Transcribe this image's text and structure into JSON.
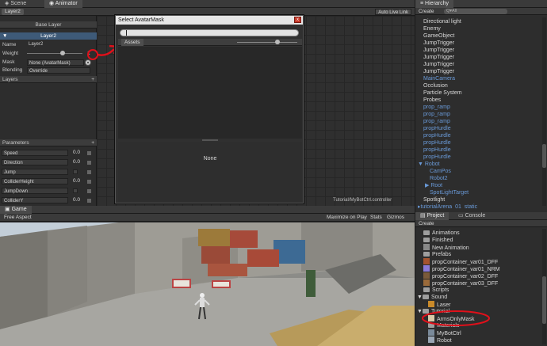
{
  "animator": {
    "tabs": [
      "Scene",
      "Animator"
    ],
    "breadcrumb": "Layer2",
    "auto_live_link": "Auto Live Link",
    "base_layer": "Base Layer",
    "layer_header": "Layer2",
    "name_label": "Name",
    "name_value": "Layer2",
    "weight_label": "Weight",
    "weight_value": "1",
    "mask_label": "Mask",
    "mask_value": "None (AvatarMask)",
    "blending_label": "Blending",
    "blending_value": "Override",
    "layers_label": "Layers",
    "parameters_label": "Parameters",
    "parameters": [
      {
        "name": "Speed",
        "value": "0.0"
      },
      {
        "name": "Direction",
        "value": "0.0"
      },
      {
        "name": "Jump",
        "value": ""
      },
      {
        "name": "ColliderHeight",
        "value": "0.0"
      },
      {
        "name": "JumpDown",
        "value": ""
      },
      {
        "name": "ColliderY",
        "value": "0.0"
      }
    ],
    "status_path": "Tutorial/MyBotCtrl.controller"
  },
  "dialog": {
    "title": "Select AvatarMask",
    "close": "x",
    "search_value": "",
    "assets_tab": "Assets",
    "preview_text": "None"
  },
  "hierarchy": {
    "title": "Hierarchy",
    "create": "Create",
    "search_placeholder": "Q▾All",
    "items": [
      "Directional light",
      "Enemy",
      "GameObject",
      "JumpTrigger",
      "JumpTrigger",
      "JumpTrigger",
      "JumpTrigger",
      "JumpTrigger",
      "MainCamera",
      "Occlusion",
      "Particle System",
      "Probes",
      "prop_ramp",
      "prop_ramp",
      "prop_ramp",
      "propHurdle",
      "propHurdle",
      "propHurdle",
      "propHurdle",
      "propHurdle",
      "Robot",
      "CamPos",
      "Robot2",
      "Root",
      "SpotLightTarget",
      "Spotlight",
      "tutorialArena_01_static"
    ]
  },
  "game": {
    "tab": "Game",
    "aspect": "Free Aspect",
    "maximize": "Maximize on Play",
    "stats": "Stats",
    "gizmos": "Gizmos"
  },
  "project": {
    "tabs": [
      "Project",
      "Console"
    ],
    "create": "Create",
    "items": [
      "Animations",
      "Finished",
      "New Animation",
      "Prefabs",
      "propContainer_var01_DFF",
      "propContainer_var01_NRM",
      "propContainer_var02_DFF",
      "propContainer_var03_DFF",
      "Scripts",
      "Sound",
      "Laser",
      "Tutorial",
      "ArmsOnlyMask",
      "Materials",
      "MyBotCtrl",
      "Robot"
    ]
  },
  "colors": {
    "annotation_red": "#e0101a",
    "hierarchy_blue": "#6a9ad8"
  }
}
